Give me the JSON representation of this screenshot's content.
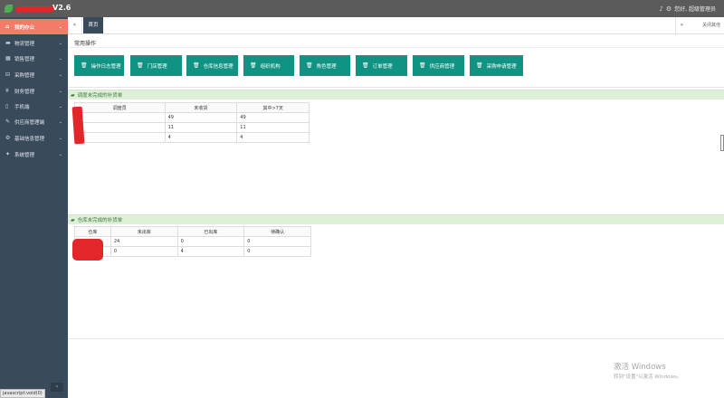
{
  "header": {
    "version": "V2.6",
    "user_text": "您好, 超级管理员"
  },
  "sidebar": {
    "items": [
      {
        "icon": "home-icon",
        "glyph": "⌂",
        "label": "我的办公"
      },
      {
        "icon": "truck-icon",
        "glyph": "▬",
        "label": "物流管理"
      },
      {
        "icon": "inventory-icon",
        "glyph": "▦",
        "label": "销售管理"
      },
      {
        "icon": "cart-icon",
        "glyph": "⊟",
        "label": "采购管理"
      },
      {
        "icon": "finance-icon",
        "glyph": "¥",
        "label": "财务管理"
      },
      {
        "icon": "phone-icon",
        "glyph": "▯",
        "label": "手机端"
      },
      {
        "icon": "link-icon",
        "glyph": "✎",
        "label": "供应商管理端"
      },
      {
        "icon": "settings-icon",
        "glyph": "⚙",
        "label": "基础信息管理"
      },
      {
        "icon": "gear-icon",
        "glyph": "✦",
        "label": "系统管理"
      }
    ],
    "status_url": "javascript:void(0)"
  },
  "tabs": {
    "home": "首页",
    "close_others": "关闭其他"
  },
  "quick_ops": {
    "title": "常用操作",
    "buttons": [
      "操作日志管理",
      "门店管理",
      "仓库信息管理",
      "组织机构",
      "角色管理",
      "订单管理",
      "供应商管理",
      "采购申请管理"
    ]
  },
  "dispatch_panel": {
    "title": "调度未完成的补货单",
    "columns": [
      "调度员",
      "未收货",
      "其中>7天"
    ],
    "rows": [
      [
        "",
        "49",
        "49"
      ],
      [
        "",
        "11",
        "11"
      ],
      [
        "",
        "4",
        "4"
      ]
    ]
  },
  "warehouse_panel": {
    "title": "仓库未完成的补货单",
    "columns": [
      "仓库",
      "未出库",
      "已出库",
      "待确认"
    ],
    "rows": [
      [
        "",
        "24",
        "0",
        "0"
      ],
      [
        "",
        "0",
        "4",
        "0"
      ]
    ]
  },
  "watermark": {
    "line1": "激活 Windows",
    "line2": "转到\"设置\"以激活 Windows。"
  },
  "colors": {
    "accent": "#109383",
    "sidebar": "#394a5b",
    "active": "#f47b68",
    "panel_head": "#dff0d8",
    "redaction": "#e3262a"
  }
}
